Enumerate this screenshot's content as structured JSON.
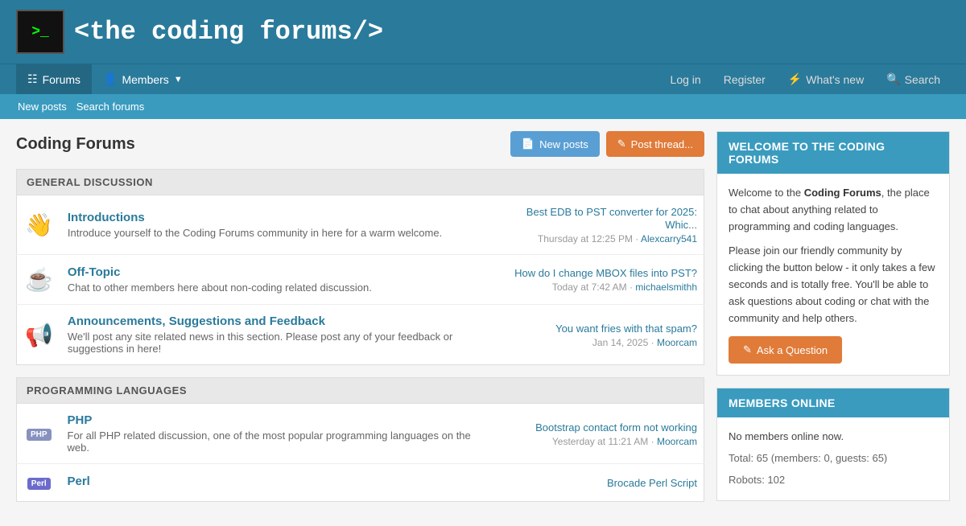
{
  "header": {
    "logo_icon": ">_",
    "logo_the": "<the>",
    "logo_text": "<the coding forums/>"
  },
  "nav": {
    "forums_label": "Forums",
    "members_label": "Members",
    "login_label": "Log in",
    "register_label": "Register",
    "whats_new_label": "What's new",
    "search_label": "Search"
  },
  "subnav": {
    "new_posts": "New posts",
    "search_forums": "Search forums"
  },
  "page": {
    "title": "Coding Forums",
    "btn_new_posts": "New posts",
    "btn_post_thread": "Post thread..."
  },
  "sections": [
    {
      "name": "GENERAL DISCUSSION",
      "forums": [
        {
          "icon": "👋",
          "name": "Introductions",
          "desc": "Introduce yourself to the Coding Forums community in here for a warm welcome.",
          "last_title": "Best EDB to PST converter for 2025: Whic...",
          "last_meta": "Thursday at 12:25 PM",
          "last_user": "Alexcarry541"
        },
        {
          "icon": "☕",
          "name": "Off-Topic",
          "desc": "Chat to other members here about non-coding related discussion.",
          "last_title": "How do I change MBOX files into PST?",
          "last_meta": "Today at 7:42 AM",
          "last_user": "michaelsmithh"
        },
        {
          "icon": "📢",
          "name": "Announcements, Suggestions and Feedback",
          "desc": "We'll post any site related news in this section. Please post any of your feedback or suggestions in here!",
          "last_title": "You want fries with that spam?",
          "last_meta": "Jan 14, 2025",
          "last_user": "Moorcam"
        }
      ]
    },
    {
      "name": "PROGRAMMING LANGUAGES",
      "forums": [
        {
          "icon": "PHP",
          "name": "PHP",
          "desc": "For all PHP related discussion, one of the most popular programming languages on the web.",
          "last_title": "Bootstrap contact form not working",
          "last_meta": "Yesterday at 11:21 AM",
          "last_user": "Moorcam"
        },
        {
          "icon": "Perl",
          "name": "Perl",
          "desc": "",
          "last_title": "Brocade Perl Script",
          "last_meta": "",
          "last_user": ""
        }
      ]
    }
  ],
  "sidebar": {
    "welcome": {
      "title": "WELCOME TO THE CODING FORUMS",
      "intro": "Welcome to the ",
      "brand": "Coding Forums",
      "intro2": ", the place to chat about anything related to programming and coding languages.",
      "body": "Please join our friendly community by clicking the button below - it only takes a few seconds and is totally free. You'll be able to ask questions about coding or chat with the community and help others.",
      "btn_label": "Ask a Question"
    },
    "members_online": {
      "title": "MEMBERS ONLINE",
      "no_members": "No members online now.",
      "total": "Total: 65 (members: 0, guests: 65)",
      "robots": "Robots: 102"
    }
  }
}
